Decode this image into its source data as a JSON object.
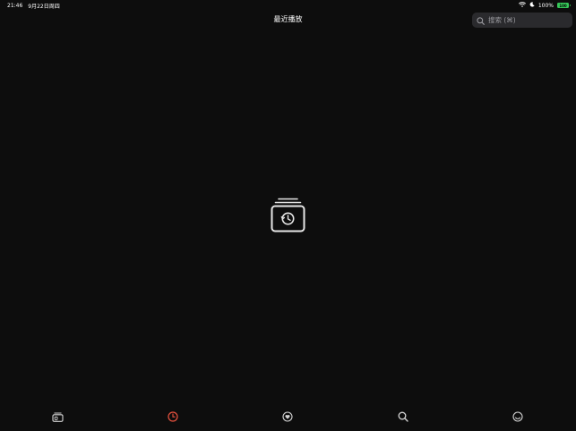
{
  "status_bar": {
    "time": "21:46",
    "date": "9月22日周四",
    "battery_percent": "100%",
    "battery_label": "100"
  },
  "header": {
    "title": "最近播放"
  },
  "search": {
    "placeholder": "搜索 (⌘)"
  },
  "empty_state": {
    "icon": "recent-history-stack-icon"
  },
  "tab_bar": {
    "active_index": 1,
    "active_color": "#e8523f",
    "inactive_color": "#d6d6d6",
    "tabs": [
      {
        "icon": "library-icon"
      },
      {
        "icon": "recent-clock-icon"
      },
      {
        "icon": "favorites-heart-icon"
      },
      {
        "icon": "search-icon"
      },
      {
        "icon": "profile-icon"
      }
    ]
  }
}
